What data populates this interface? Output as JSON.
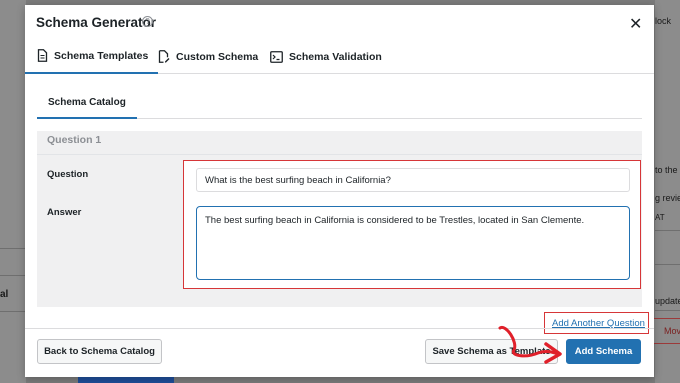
{
  "background": {
    "right_fragments": [
      "lock",
      "to the t",
      "g revie",
      "AT",
      "update",
      "Mov"
    ],
    "left_fragments": [
      "al"
    ]
  },
  "modal": {
    "title": "Schema Generator",
    "help_glyph": "?",
    "close_glyph": "✕"
  },
  "tabs": [
    {
      "label": "Schema Templates",
      "icon": "document-icon",
      "active": true
    },
    {
      "label": "Custom Schema",
      "icon": "edit-document-icon",
      "active": false
    },
    {
      "label": "Schema Validation",
      "icon": "terminal-icon",
      "active": false
    }
  ],
  "subtab": {
    "label": "Schema Catalog"
  },
  "faq": {
    "heading": "Question 1",
    "question_label": "Question",
    "question_value": "What is the best surfing beach in California?",
    "answer_label": "Answer",
    "answer_value": "The best surfing beach in California is considered to be Trestles, located in San Clemente."
  },
  "actions": {
    "add_question": "Add Another Question",
    "back": "Back to Schema Catalog",
    "save_template": "Save Schema as Template",
    "add_schema": "Add Schema"
  },
  "colors": {
    "accent": "#2271b1",
    "highlight": "#d63638",
    "annotation_arrow": "#e0202a"
  }
}
